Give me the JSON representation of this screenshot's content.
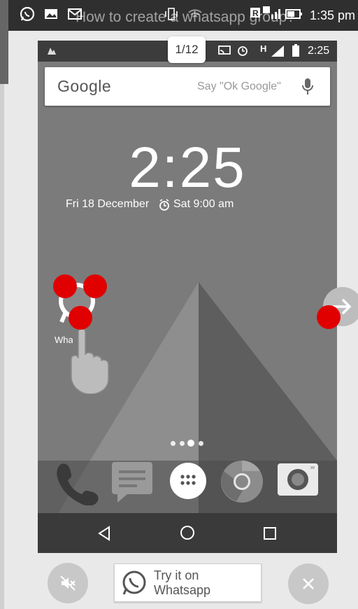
{
  "outer_status": {
    "title_overlay": "How to create a whatsapp group?",
    "clock": "1:35 pm",
    "icons": [
      "whatsapp-icon",
      "image-icon",
      "mail-icon",
      "vibrate-icon",
      "wifi-icon",
      "signal-icon",
      "battery-icon"
    ]
  },
  "page_indicator": "1/12",
  "phone": {
    "status_clock": "2:25",
    "status_net": "H",
    "search_logo": "Google",
    "search_hint": "Say \"Ok Google\"",
    "clock": "2:25",
    "date": "Fri 18 December",
    "alarm": "Sat 9:00 am",
    "app_label": "Whatsapp",
    "dock_icons": [
      "phone-icon",
      "messages-icon",
      "app-drawer-icon",
      "chrome-icon",
      "camera-icon"
    ],
    "nav_icons": [
      "back-icon",
      "home-icon",
      "recents-icon"
    ]
  },
  "bottom": {
    "try_label": "Try it on Whatsapp"
  },
  "colors": {
    "highlight": "#e00000",
    "status_bg": "#2f2f2f"
  }
}
